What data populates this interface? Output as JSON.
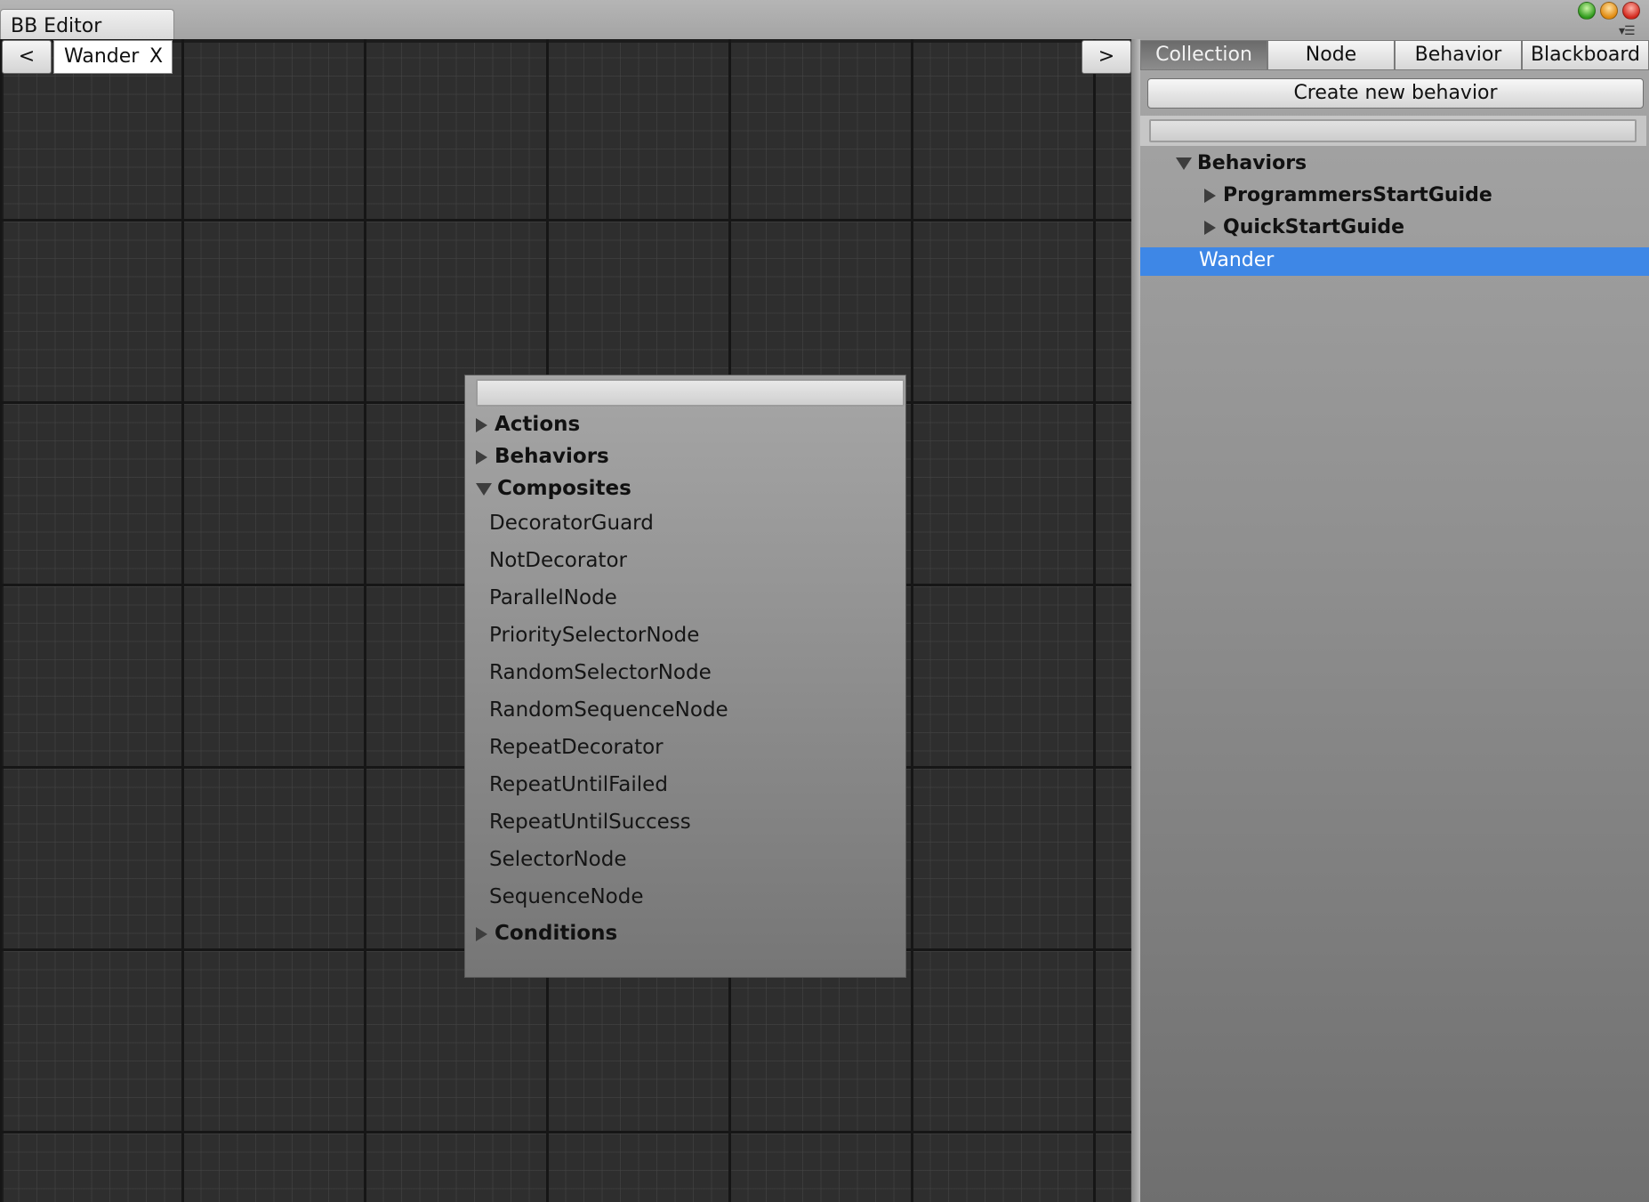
{
  "window": {
    "title": "BB Editor",
    "menu_glyph": "▾☰"
  },
  "canvas_toolbar": {
    "prev_label": "<",
    "next_label": ">",
    "open_tab": {
      "label": "Wander",
      "close_label": "X"
    }
  },
  "popup": {
    "search_value": "",
    "categories": [
      {
        "label": "Actions",
        "expanded": false
      },
      {
        "label": "Behaviors",
        "expanded": false
      },
      {
        "label": "Composites",
        "expanded": true
      },
      {
        "label": "Conditions",
        "expanded": false
      }
    ],
    "composites_items": [
      "DecoratorGuard",
      "NotDecorator",
      "ParallelNode",
      "PrioritySelectorNode",
      "RandomSelectorNode",
      "RandomSequenceNode",
      "RepeatDecorator",
      "RepeatUntilFailed",
      "RepeatUntilSuccess",
      "SelectorNode",
      "SequenceNode"
    ]
  },
  "panel": {
    "tabs": [
      {
        "label": "Collection",
        "active": true
      },
      {
        "label": "Node",
        "active": false
      },
      {
        "label": "Behavior",
        "active": false
      },
      {
        "label": "Blackboard",
        "active": false
      }
    ],
    "create_button_label": "Create new behavior",
    "search_value": "",
    "tree": {
      "root": {
        "label": "Behaviors",
        "expanded": true
      },
      "children": [
        {
          "label": "ProgrammersStartGuide",
          "expanded": false
        },
        {
          "label": "QuickStartGuide",
          "expanded": false
        }
      ],
      "selected_item": "Wander"
    }
  },
  "colors": {
    "selection": "#3e87e6",
    "canvas_bg": "#2e2e2e"
  }
}
